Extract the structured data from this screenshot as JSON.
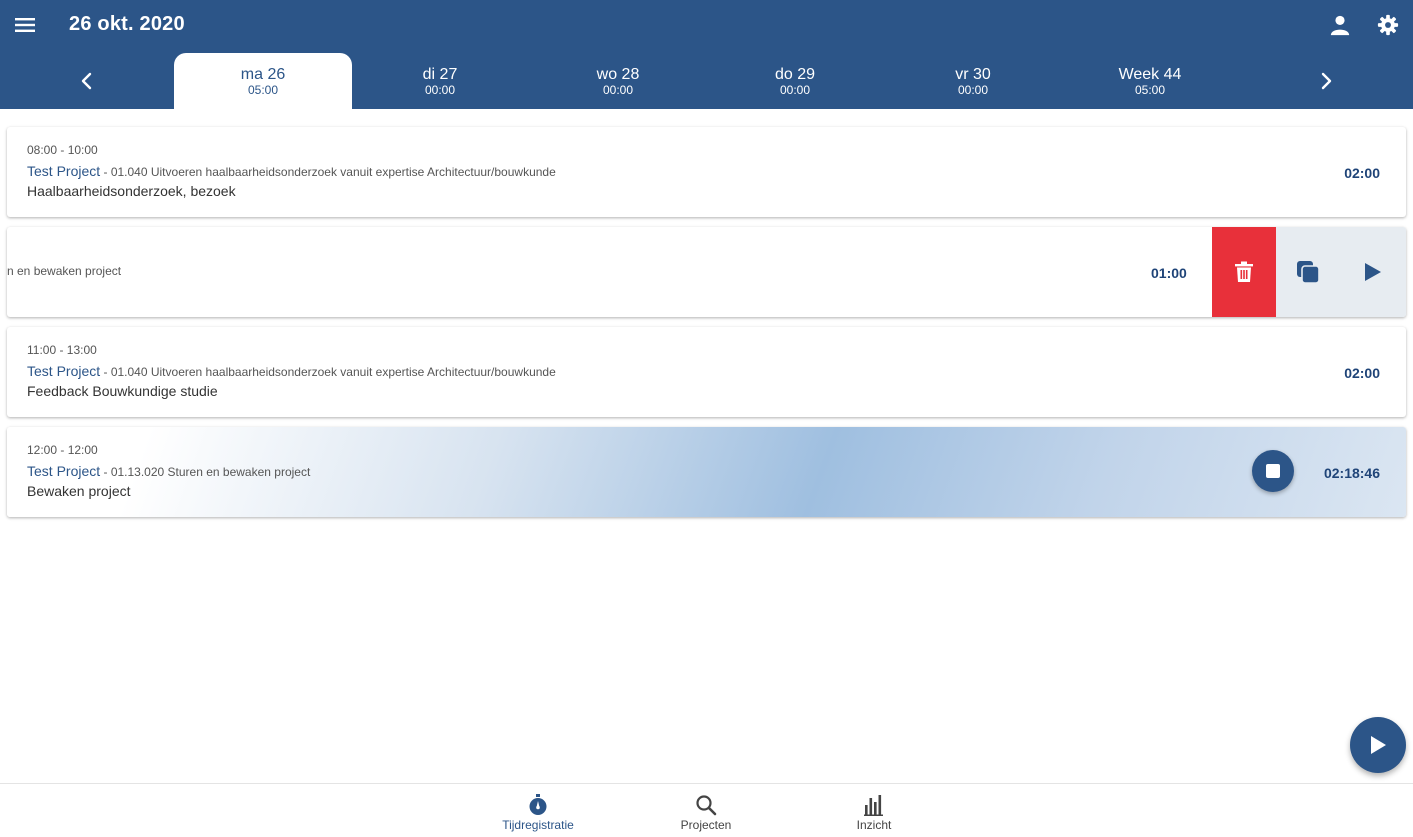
{
  "header": {
    "title": "26 okt. 2020",
    "menu_icon": "menu-icon",
    "user_icon": "user-icon",
    "settings_icon": "gear-icon",
    "color": "#2c5588"
  },
  "days": [
    {
      "label": "ma 26",
      "hours": "05:00",
      "active": true
    },
    {
      "label": "di 27",
      "hours": "00:00"
    },
    {
      "label": "wo 28",
      "hours": "00:00"
    },
    {
      "label": "do 29",
      "hours": "00:00"
    },
    {
      "label": "vr 30",
      "hours": "00:00"
    },
    {
      "label": "Week 44",
      "hours": "05:00"
    }
  ],
  "entries": [
    {
      "time": "08:00 - 10:00",
      "project": "Test Project",
      "separator": " - ",
      "task": "01.040 Uitvoeren haalbaarheidsonderzoek vanuit expertise Architectuur/bouwkunde",
      "description": "Haalbaarheidsonderzoek, bezoek",
      "duration": "02:00"
    },
    {
      "task_partial": "n en bewaken project",
      "duration": "01:00",
      "actions": {
        "delete_icon": "trash-icon",
        "copy_icon": "copy-icon",
        "play_icon": "play-icon",
        "delete_color": "#e8303a"
      }
    },
    {
      "time": "11:00 - 13:00",
      "project": "Test Project",
      "separator": " - ",
      "task": "01.040 Uitvoeren haalbaarheidsonderzoek vanuit expertise Architectuur/bouwkunde",
      "description": "Feedback Bouwkundige studie",
      "duration": "02:00"
    },
    {
      "time": "12:00 - 12:00",
      "project": "Test Project",
      "separator": " - ",
      "task": "01.13.020 Sturen en bewaken project",
      "description": "Bewaken project",
      "duration": "02:18:46",
      "running": true,
      "stop_icon": "stop-icon"
    }
  ],
  "fab": {
    "icon": "play-icon"
  },
  "bottom_nav": [
    {
      "label": "Tijdregistratie",
      "icon": "stopwatch-icon",
      "active": true
    },
    {
      "label": "Projecten",
      "icon": "search-icon"
    },
    {
      "label": "Inzicht",
      "icon": "bar-chart-icon"
    }
  ]
}
